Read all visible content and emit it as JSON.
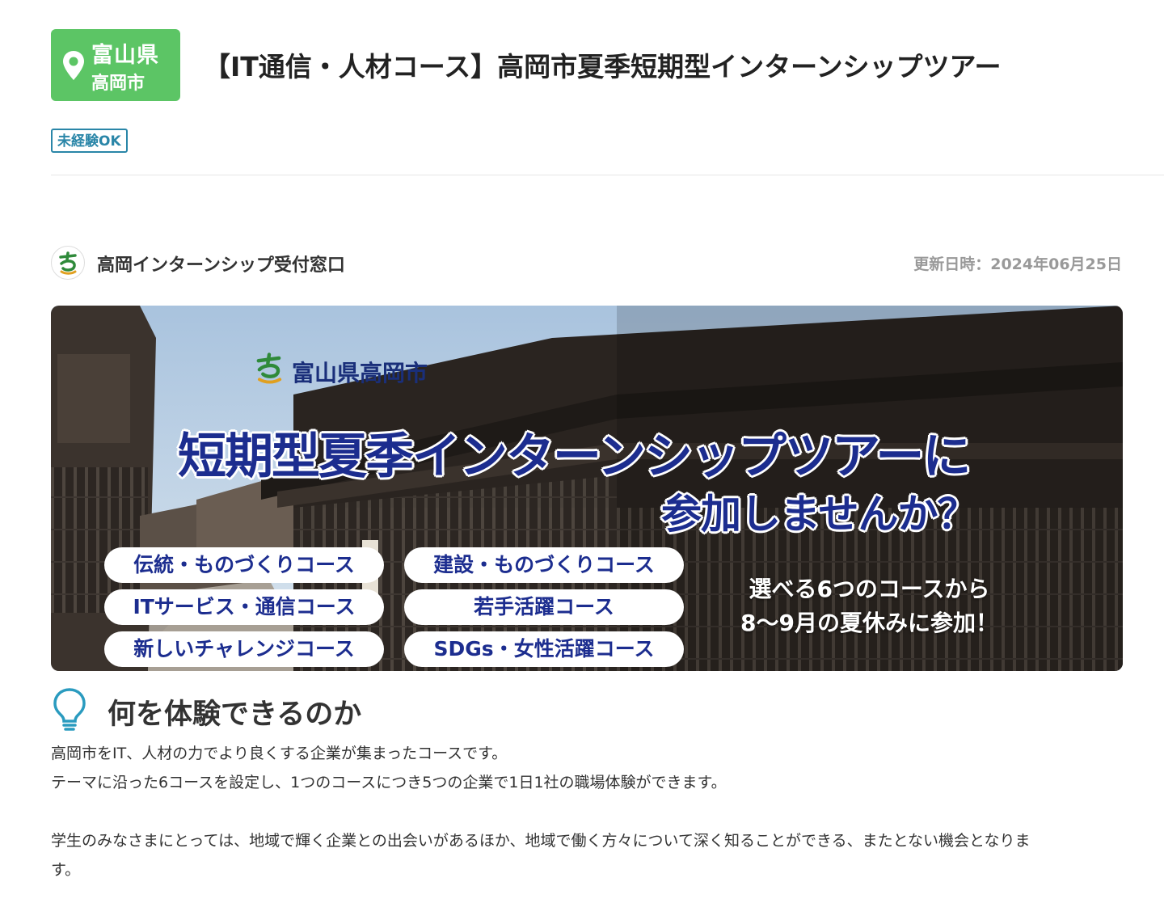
{
  "header": {
    "prefecture": "富山県",
    "city": "高岡市",
    "title": "【IT通信・人材コース】高岡市夏季短期型インターンシップツアー",
    "tag": "未経験OK"
  },
  "meta": {
    "organizer": "高岡インターンシップ受付窓口",
    "updated": "更新日時：2024年06月25日"
  },
  "banner": {
    "logo_text": "富山県高岡市",
    "headline": "短期型夏季インターンシップツアーに",
    "subheadline": "参加しませんか？",
    "courses": [
      "伝統・ものづくりコース",
      "建設・ものづくりコース",
      "ITサービス・通信コース",
      "若手活躍コース",
      "新しいチャレンジコース",
      "SDGs・女性活躍コース"
    ],
    "note_line1": "選べる6つのコースから",
    "note_line2": "8〜9月の夏休みに参加！"
  },
  "section": {
    "icon": "lightbulb-icon",
    "title": "何を体験できるのか",
    "p1": "高岡市をIT、人材の力でより良くする企業が集まったコースです。",
    "p2": "テーマに沿った6コースを設定し、1つのコースにつき5つの企業で1日1社の職場体験ができます。",
    "p3": "学生のみなさまにとっては、地域で輝く企業との出会いがあるほか、地域で働く方々について深く知ることができる、またとない機会となりま",
    "p4": "す。"
  },
  "colors": {
    "badge_green": "#5cc565",
    "tag_blue": "#2a86a8",
    "banner_navy": "#1c2d8f"
  }
}
